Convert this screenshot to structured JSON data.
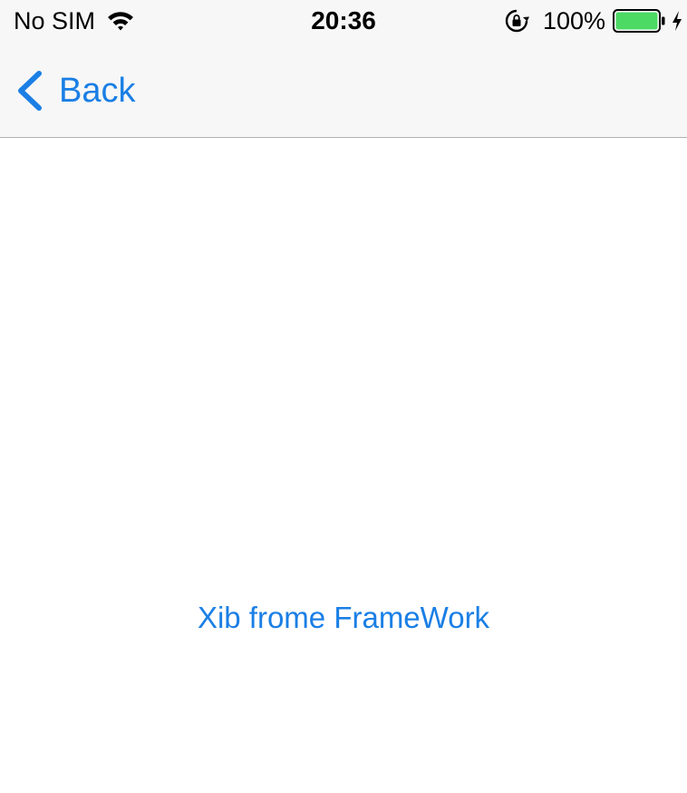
{
  "status_bar": {
    "carrier": "No SIM",
    "time": "20:36",
    "battery_percent": "100%",
    "battery_level": 1.0,
    "icons": [
      "wifi-icon",
      "lock-rotation-icon",
      "battery-icon",
      "charging-icon"
    ]
  },
  "nav": {
    "back_label": "Back",
    "back_icon": "chevron-left-icon"
  },
  "main": {
    "button_label": "Xib frome FrameWork"
  },
  "colors": {
    "accent": "#1a7fe5",
    "nav_background": "#f7f7f7",
    "separator": "#b2b2b2",
    "battery_fill": "#4cd964"
  }
}
